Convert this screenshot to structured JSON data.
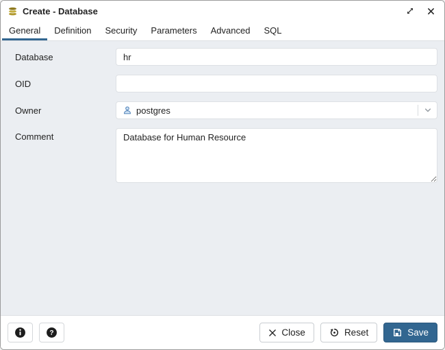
{
  "dialog": {
    "title": "Create - Database"
  },
  "tabs": [
    {
      "label": "General",
      "active": true
    },
    {
      "label": "Definition",
      "active": false
    },
    {
      "label": "Security",
      "active": false
    },
    {
      "label": "Parameters",
      "active": false
    },
    {
      "label": "Advanced",
      "active": false
    },
    {
      "label": "SQL",
      "active": false
    }
  ],
  "form": {
    "fields": [
      {
        "label": "Database",
        "type": "text",
        "value": "hr"
      },
      {
        "label": "OID",
        "type": "text",
        "value": ""
      },
      {
        "label": "Owner",
        "type": "select",
        "value": "postgres",
        "icon": "user-icon"
      },
      {
        "label": "Comment",
        "type": "textarea",
        "value": "Database for Human Resource"
      }
    ]
  },
  "footer": {
    "close_label": "Close",
    "reset_label": "Reset",
    "save_label": "Save"
  },
  "icons": {
    "header_left": "database-icon",
    "window": [
      "maximize-icon",
      "close-window-icon"
    ],
    "owner_field": [
      "user-icon",
      "chevron-down-icon"
    ],
    "footer_left": [
      "info-icon",
      "help-icon"
    ],
    "footer_right": [
      "close-icon",
      "reset-icon",
      "save-icon"
    ]
  },
  "colors": {
    "primary": "#326690",
    "content_bg": "#ebeef2",
    "input_border": "#dde0e4",
    "database_icon_gold": "#b1992f"
  }
}
